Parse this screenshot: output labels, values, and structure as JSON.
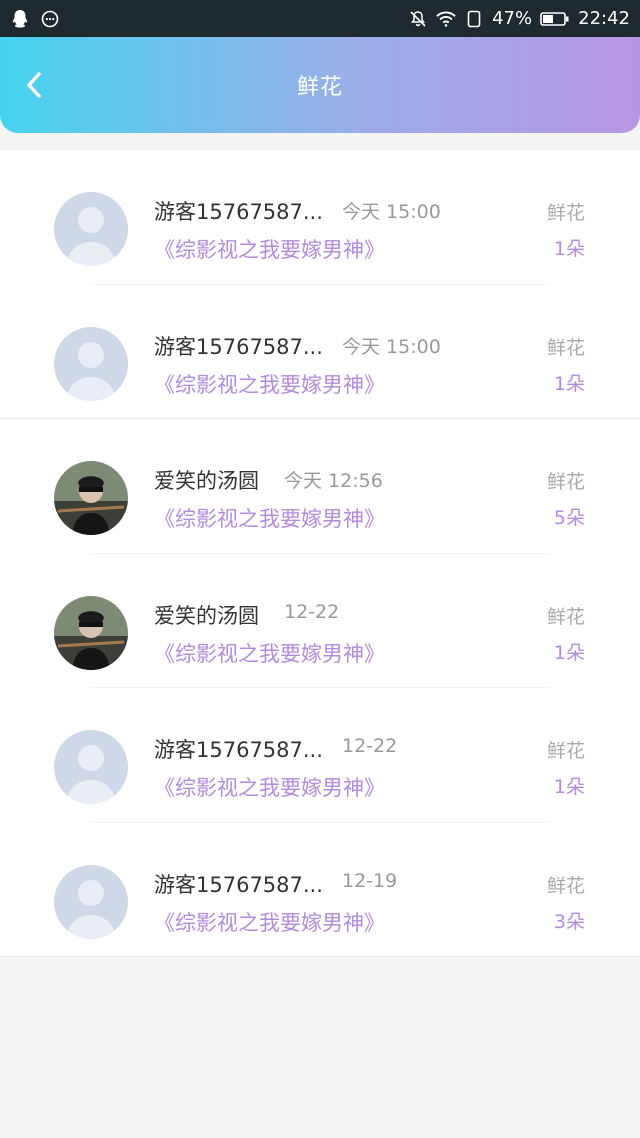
{
  "status_bar": {
    "battery": "47%",
    "time": "22:42"
  },
  "header": {
    "title": "鲜花"
  },
  "rows": [
    {
      "name": "游客15767587...",
      "time": "今天 15:00",
      "book": "《综影视之我要嫁男神》",
      "label": "鲜花",
      "count": "1朵",
      "avatar": "default-avatar"
    },
    {
      "name": "游客15767587...",
      "time": "今天 15:00",
      "book": "《综影视之我要嫁男神》",
      "label": "鲜花",
      "count": "1朵",
      "avatar": "default-avatar"
    },
    {
      "name": "爱笑的汤圆",
      "time": "今天 12:56",
      "book": "《综影视之我要嫁男神》",
      "label": "鲜花",
      "count": "5朵",
      "avatar": "photo-avatar"
    },
    {
      "name": "爱笑的汤圆",
      "time": "12-22",
      "book": "《综影视之我要嫁男神》",
      "label": "鲜花",
      "count": "1朵",
      "avatar": "photo-avatar"
    },
    {
      "name": "游客15767587...",
      "time": "12-22",
      "book": "《综影视之我要嫁男神》",
      "label": "鲜花",
      "count": "1朵",
      "avatar": "default-avatar"
    },
    {
      "name": "游客15767587...",
      "time": "12-19",
      "book": "《综影视之我要嫁男神》",
      "label": "鲜花",
      "count": "3朵",
      "avatar": "default-avatar"
    }
  ],
  "colors": {
    "header_start": "#45d3ef",
    "header_end": "#b896e6",
    "accent": "#b48adb"
  }
}
